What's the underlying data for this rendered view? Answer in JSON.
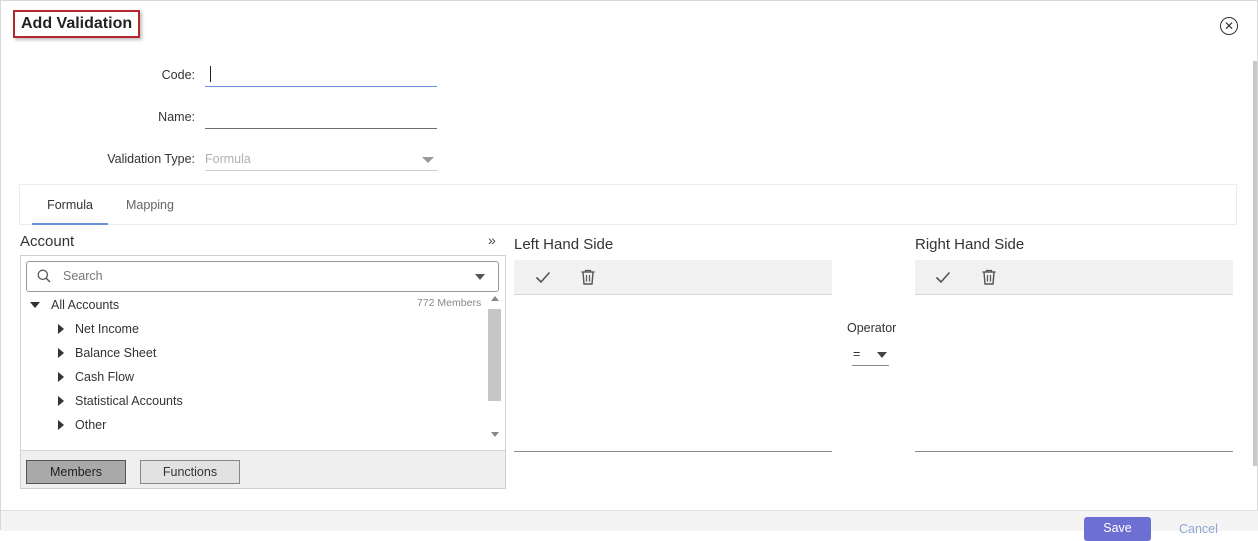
{
  "dialog": {
    "title": "Add Validation",
    "close_icon": "close-circle-icon"
  },
  "form": {
    "code_label": "Code:",
    "code_value": "",
    "name_label": "Name:",
    "name_value": "",
    "validation_type_label": "Validation Type:",
    "validation_type_value": "Formula"
  },
  "tabs": [
    {
      "label": "Formula",
      "active": true
    },
    {
      "label": "Mapping",
      "active": false
    }
  ],
  "account_panel": {
    "title": "Account",
    "expand_icon": "double-chevron-right-icon",
    "search_placeholder": "Search",
    "root": {
      "label": "All Accounts",
      "count": "772 Members"
    },
    "items": [
      {
        "label": "Net Income"
      },
      {
        "label": "Balance Sheet"
      },
      {
        "label": "Cash Flow"
      },
      {
        "label": "Statistical Accounts"
      },
      {
        "label": "Other"
      }
    ],
    "footer_buttons": [
      {
        "label": "Members",
        "active": true
      },
      {
        "label": "Functions",
        "active": false
      }
    ]
  },
  "left_side": {
    "title": "Left Hand Side",
    "toolbar_icons": [
      "check-icon",
      "trash-icon"
    ]
  },
  "operator": {
    "label": "Operator",
    "value": "="
  },
  "right_side": {
    "title": "Right Hand Side",
    "toolbar_icons": [
      "check-icon",
      "trash-icon"
    ]
  },
  "footer": {
    "save_label": "Save",
    "cancel_label": "Cancel"
  },
  "colors": {
    "title_border": "#b3282d",
    "accent": "#6d8fd8",
    "save_button": "#6e6fd2"
  }
}
